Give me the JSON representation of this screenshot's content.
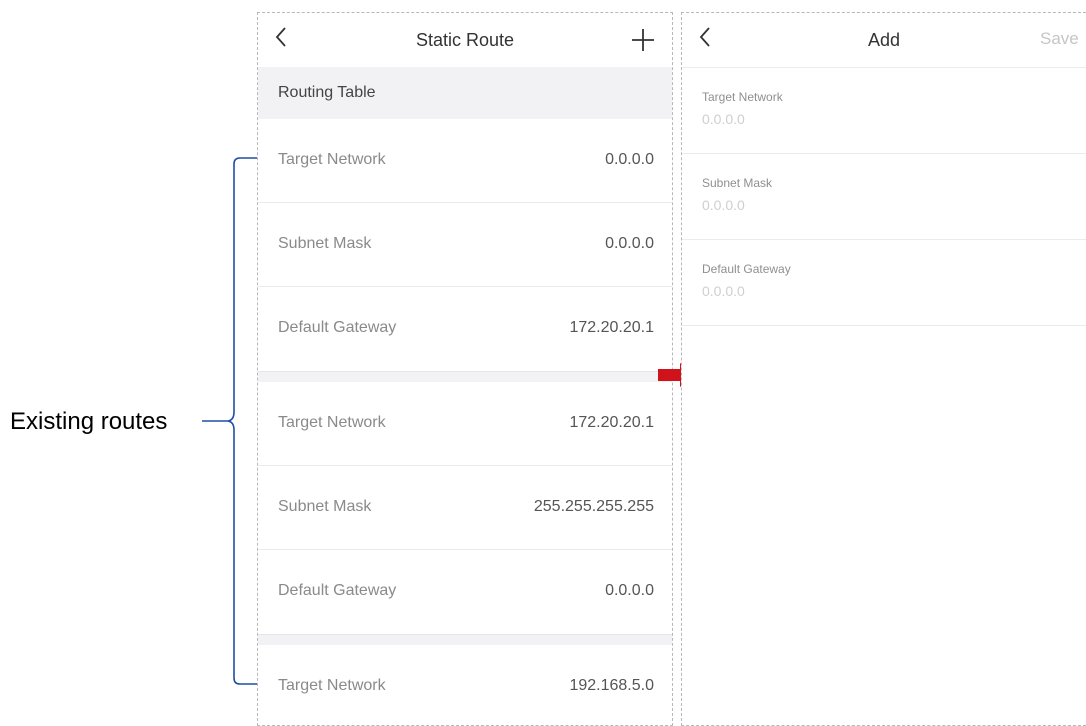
{
  "left_screen": {
    "title": "Static Route",
    "section_title": "Routing Table",
    "routes": [
      {
        "target_label": "Target Network",
        "target_value": "0.0.0.0",
        "mask_label": "Subnet Mask",
        "mask_value": "0.0.0.0",
        "gateway_label": "Default Gateway",
        "gateway_value": "172.20.20.1"
      },
      {
        "target_label": "Target Network",
        "target_value": "172.20.20.1",
        "mask_label": "Subnet Mask",
        "mask_value": "255.255.255.255",
        "gateway_label": "Default Gateway",
        "gateway_value": "0.0.0.0"
      },
      {
        "target_label": "Target Network",
        "target_value": "192.168.5.0"
      }
    ]
  },
  "right_screen": {
    "title": "Add",
    "save_label": "Save",
    "fields": [
      {
        "label": "Target Network",
        "placeholder": "0.0.0.0"
      },
      {
        "label": "Subnet Mask",
        "placeholder": "0.0.0.0"
      },
      {
        "label": "Default Gateway",
        "placeholder": "0.0.0.0"
      }
    ]
  },
  "annotation": {
    "label": "Existing routes"
  },
  "colors": {
    "arrow": "#d0121b",
    "bracket": "#1f4ea6",
    "section_bg": "#f2f2f4"
  }
}
